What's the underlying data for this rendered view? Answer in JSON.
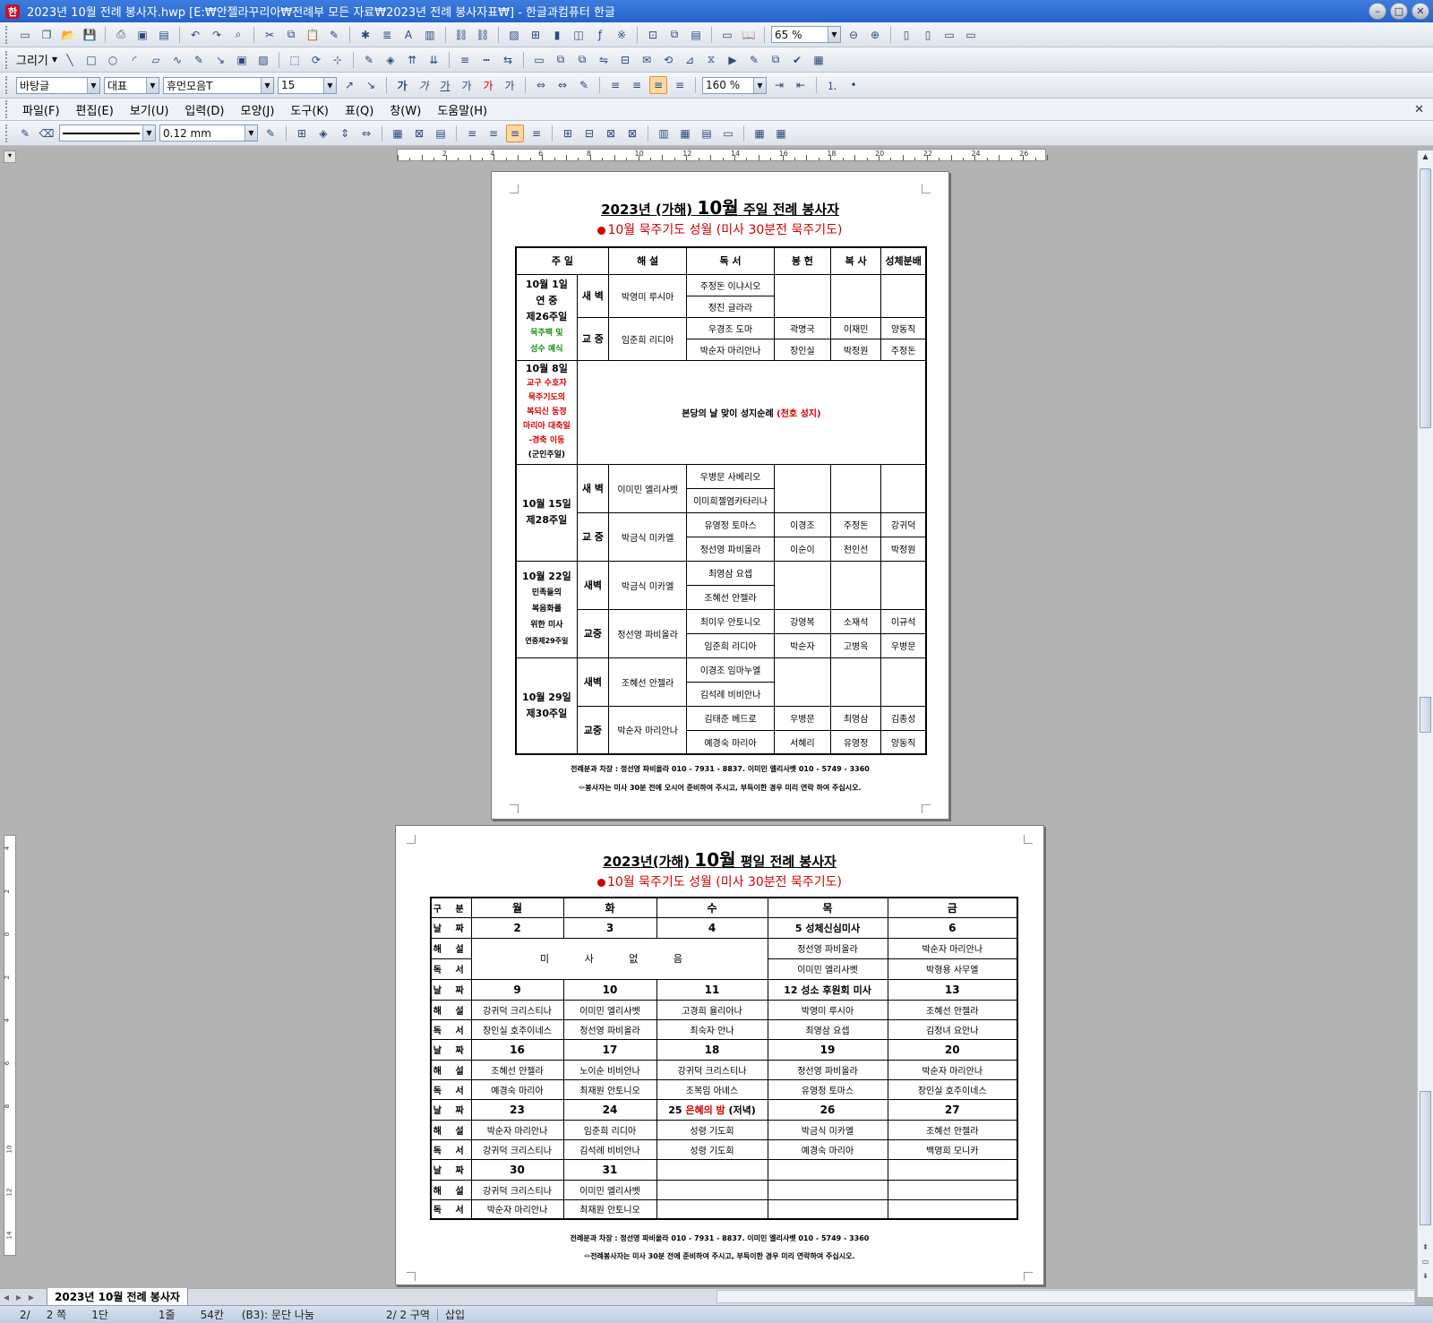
{
  "window": {
    "title": "2023년 10월 전례 봉사자.hwp [E:₩안젤라꾸리아₩전례부 모든 자료₩2023년 전례 봉사자표₩] - 한글과컴퓨터 한글"
  },
  "toolbar1": {
    "zoom": "65 %"
  },
  "toolbar2": {
    "draw_label": "그리기"
  },
  "format_bar": {
    "style": "바탕글",
    "lang": "대표",
    "font": "휴먼모음T",
    "size": "15",
    "line_spacing": "160 %"
  },
  "menu": [
    "파일(F)",
    "편집(E)",
    "보기(U)",
    "입력(D)",
    "모양(J)",
    "도구(K)",
    "표(Q)",
    "창(W)",
    "도움말(H)"
  ],
  "table_bar": {
    "line_width": "0.12 mm"
  },
  "ruler": {
    "h_numbers": [
      "2",
      "4",
      "6",
      "8",
      "10",
      "12",
      "14",
      "16",
      "18",
      "20",
      "22",
      "24",
      "26"
    ],
    "v_numbers": [
      "4",
      "2",
      "0",
      "2",
      "4",
      "6",
      "8",
      "10",
      "12",
      "14"
    ]
  },
  "sunday": {
    "title_pre": "2023년 (가해)",
    "title_big": "10월",
    "title_post": "주일 전례 봉사자",
    "subtitle": "10월 묵주기도 성월 (미사 30분전 묵주기도)",
    "headers": [
      "주 일",
      "해 설",
      "독 서",
      "봉 헌",
      "복 사",
      "성체분배"
    ],
    "w1": {
      "date": "10월 1일",
      "name1": "연 중",
      "name2": "제26주일",
      "note1": "묵주팩 및",
      "note2": "성수 예식"
    },
    "w2": {
      "date": "10월 8일",
      "n1": "교구 수호자",
      "n2": "묵주기도의",
      "n3": "복되신 동정",
      "n4": "마리아 대축일",
      "n5": "-경축 이동",
      "n6": "(군인주일)",
      "event": "본당의 날 맞이 성지순례",
      "event_red": "(천호 성지)"
    },
    "w3": {
      "date": "10월 15일",
      "name": "제28주일"
    },
    "w4": {
      "date": "10월 22일",
      "n1": "민족들의",
      "n2": "복음화를",
      "n3": "위한 미사",
      "n4": "연중제29주일"
    },
    "w5": {
      "date": "10월 29일",
      "name": "제30주일"
    },
    "mass_dawn": "새 벽",
    "mass_school": "교 중",
    "mass_dawn2": "새벽",
    "mass_school2": "교중",
    "rows": {
      "w1a": [
        "박영미 루시아",
        "주정돈 이냐시오",
        "정진 글라라"
      ],
      "w1b": [
        "임준희 리디아",
        "우경조 도마",
        "박순자 마리안나",
        "곽명국",
        "장인실",
        "이재민",
        "박정원",
        "양동직",
        "주정돈"
      ],
      "w3a": [
        "이미민 엘리사벳",
        "우병문 사베리오",
        "이미희젤염카타리나"
      ],
      "w3b": [
        "박금식 미카엘",
        "유영정 토마스",
        "정선영 파비올라",
        "이경조",
        "이순이",
        "주정돈",
        "천인선",
        "강귀덕",
        "박정원"
      ],
      "w4a": [
        "박금식 미카엘",
        "최영삼 요셉",
        "조혜선 안젤라"
      ],
      "w4b": [
        "정선영 파비올라",
        "최이우 안토니오",
        "임준희 리디아",
        "강영복",
        "박순자",
        "소재석",
        "고병옥",
        "이규석",
        "우병문"
      ],
      "w5a": [
        "조혜선 안젤라",
        "이경조 임마누엘",
        "김석례 비비안나"
      ],
      "w5b": [
        "박순자 마리안나",
        "김태준 베드로",
        "예경숙 마리아",
        "우병문",
        "서혜리",
        "최영삼",
        "유영정",
        "김종성",
        "양동직"
      ]
    },
    "contact": "전례분과 차장 : 정선영 파비올라 010 - 7931 - 8837. 이미민 엘리사벳 010 - 5749 - 3360",
    "notice": "✏봉사자는 미사 30분 전에 오시어 준비하여 주시고, 부득이한 경우 미리 연락 하여 주십시오."
  },
  "weekday": {
    "title_pre": "2023년(가해)",
    "title_big": "10월",
    "title_post": "평일 전례 봉사자",
    "subtitle": "10월 묵주기도 성월 (미사 30분전 묵주기도)",
    "headers": [
      "구 분",
      "월",
      "화",
      "수",
      "목",
      "금"
    ],
    "label_date": "날 짜",
    "label_com": "해 설",
    "label_read": "독 서",
    "no_mass": "미 사 없 음",
    "wk1": {
      "dates": [
        "2",
        "3",
        "4",
        "5 성체신심미사",
        "6"
      ],
      "thu_com": "정선영 파비올라",
      "fri_com": "박순자 마리안나",
      "thu_read": "이미민 엘리사벳",
      "fri_read": "박형용 사무엘"
    },
    "wk2": {
      "dates": [
        "9",
        "10",
        "11",
        "12 성소 후원회 미사",
        "13"
      ],
      "com": [
        "강귀덕 크리스티나",
        "이미민 엘리사벳",
        "고경희 율리아나",
        "박영미 루시아",
        "조혜선 안젤라"
      ],
      "read": [
        "장인실 호주이네스",
        "정선영 파비올라",
        "최숙자 안나",
        "최영삼 요셉",
        "김정녀 요안나"
      ]
    },
    "wk3": {
      "dates": [
        "16",
        "17",
        "18",
        "19",
        "20"
      ],
      "com": [
        "조혜선 안젤라",
        "노이순 비비안나",
        "강귀덕 크리스티나",
        "정선영 파비올라",
        "박순자 마리안나"
      ],
      "read": [
        "예경숙 마리아",
        "최재원 안토니오",
        "조복임 아녜스",
        "유영정 토마스",
        "장인실 호주이네스"
      ]
    },
    "wk4": {
      "dates": [
        "23",
        "24",
        "26",
        "27"
      ],
      "wed_pre": "25",
      "wed_red": "은혜의 밤",
      "wed_post": "(저녁)",
      "com": [
        "박순자 마리안나",
        "임준희 리디아",
        "성령 기도회",
        "박금식 미카엘",
        "조혜선 안젤라"
      ],
      "read": [
        "강귀덕 크리스티나",
        "김석례 비비안나",
        "성령 기도회",
        "예경숙 마리아",
        "백영희 모니카"
      ]
    },
    "wk5": {
      "dates": [
        "30",
        "31"
      ],
      "com": [
        "강귀덕 크리스티나",
        "이미민 엘리사벳"
      ],
      "read": [
        "박순자 마리안나",
        "최재원 안토니오"
      ]
    },
    "contact": "전례분과 차장 : 정선영 파비올라 010 - 7931 - 8837. 이미민 엘리사벳 010 - 5749 - 3360",
    "notice": "✏전례봉사자는 미사 30분 전에 준비하여 주시고, 부득이한 경우 미리 연락하여 주십시오."
  },
  "tab": {
    "label": "2023년 10월 전례 봉사자"
  },
  "status": {
    "page": "2/",
    "total": "2 쪽",
    "col": "1단",
    "line": "1줄",
    "char": "54칸",
    "info": "(B3): 문단 나눔",
    "section": "2/ 2 구역",
    "mode": "삽입"
  }
}
